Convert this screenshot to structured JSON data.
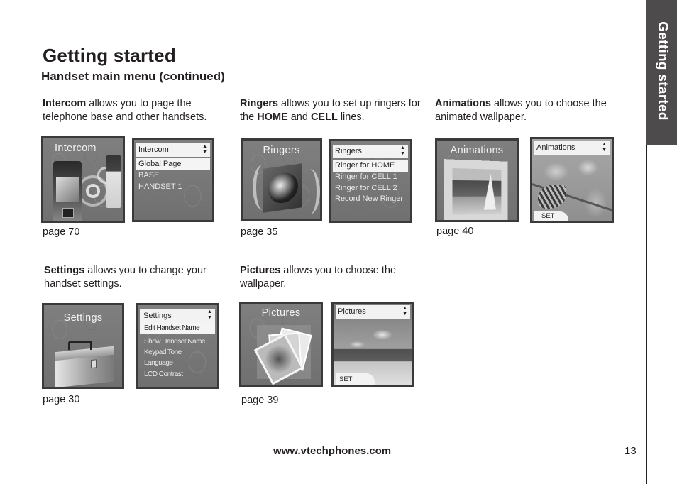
{
  "header": {
    "title": "Getting started",
    "subtitle": "Handset main menu (continued)"
  },
  "side_tab": {
    "label": "Getting started",
    "color": "#4d4b4c"
  },
  "sections": {
    "intercom": {
      "bold": "Intercom",
      "text": " allows you to page the telephone base and other handsets.",
      "icon_screen_label": "Intercom",
      "menu_title": "Intercom",
      "menu_items": [
        "Global Page",
        "BASE",
        "HANDSET 1"
      ],
      "selected_index": 0,
      "page_ref": "page 70"
    },
    "ringers": {
      "bold": "Ringers",
      "text1": " allows you to set up ringers for the ",
      "bold2": "HOME",
      "text2": " and ",
      "bold3": "CELL",
      "text3": " lines.",
      "icon_screen_label": "Ringers",
      "menu_title": "Ringers",
      "menu_items": [
        "Ringer for HOME",
        "Ringer for CELL 1",
        "Ringer for CELL 2",
        "Record New Ringer"
      ],
      "selected_index": 0,
      "page_ref": "page 35"
    },
    "animations": {
      "bold": "Animations",
      "text": " allows you to choose the animated wallpaper.",
      "icon_screen_label": "Animations",
      "menu_title": "Animations",
      "softkey": "SET",
      "page_ref": "page 40"
    },
    "settings": {
      "bold": "Settings",
      "text": " allows you to change your handset settings.",
      "icon_screen_label": "Settings",
      "menu_title": "Settings",
      "menu_items": [
        "Edit Handset Name",
        "Show Handset Name",
        "Keypad Tone",
        "Language",
        "LCD Contrast"
      ],
      "selected_index": 0,
      "page_ref": "page 30"
    },
    "pictures": {
      "bold": "Pictures",
      "text": " allows you to choose the wallpaper.",
      "icon_screen_label": "Pictures",
      "menu_title": "Pictures",
      "softkey": "SET",
      "page_ref": "page 39"
    }
  },
  "footer": {
    "url": "www.vtechphones.com",
    "page_number": "13"
  },
  "icons": {
    "scroll_arrows": "▲▼"
  }
}
